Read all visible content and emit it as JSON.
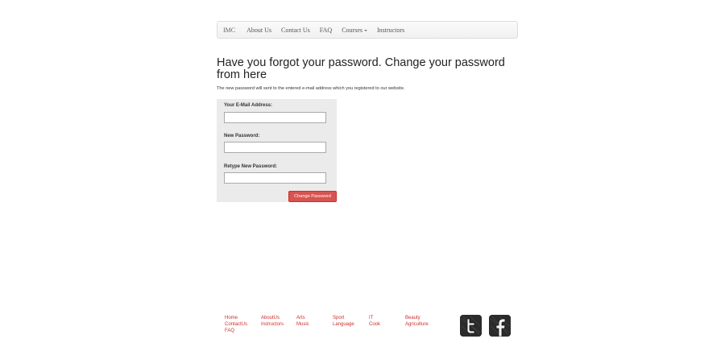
{
  "nav": {
    "brand": "IMC",
    "items": [
      "About Us",
      "Contact Us",
      "FAQ",
      "Courses",
      "Instructors"
    ]
  },
  "main": {
    "title": "Have you forgot your password. Change your password from here",
    "description": "The new password will sent to the entered e-mail address which you registered to our website."
  },
  "form": {
    "email_label": "Your E-Mail Address:",
    "email_value": "",
    "new_password_label": "New Password:",
    "new_password_value": "",
    "retype_label": "Retype New Password:",
    "retype_value": "",
    "submit_label": "Change Password"
  },
  "footer": {
    "columns": [
      [
        "Home",
        "ContactUs",
        "FAQ"
      ],
      [
        "AboutUs",
        "Instructors"
      ],
      [
        "Arts",
        "Music"
      ],
      [
        "Sport",
        "Language"
      ],
      [
        "IT",
        "Cook"
      ],
      [
        "Beauty",
        "Agriculture"
      ]
    ],
    "social": [
      "twitter-icon",
      "facebook-icon"
    ]
  },
  "colors": {
    "accent": "#d9534f",
    "link": "#c9302c",
    "form_bg": "#ebebeb"
  }
}
